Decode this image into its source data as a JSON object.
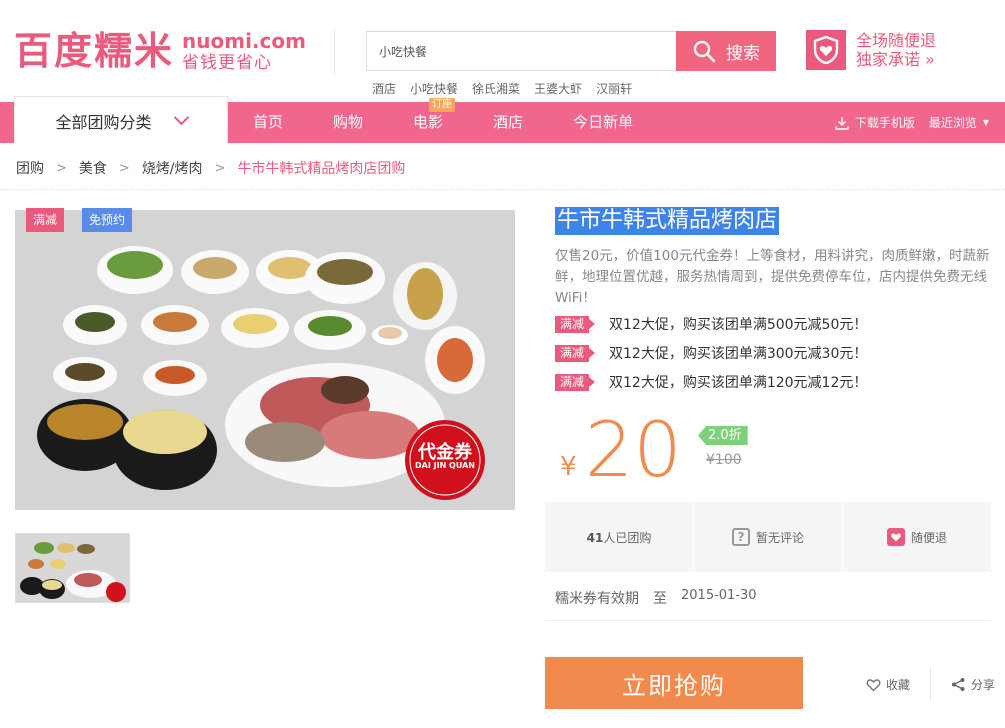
{
  "header": {
    "logo_cn": "百度糯米",
    "logo_en": "nuomi.com",
    "logo_slogan": "省钱更省心",
    "search": {
      "value": "小吃快餐",
      "button_label": "搜索"
    },
    "hot_words": [
      "酒店",
      "小吃快餐",
      "徐氏湘菜",
      "王婆大虾",
      "汉丽轩"
    ],
    "promise_line1": "全场随便退",
    "promise_line2": "独家承诺 »"
  },
  "nav": {
    "category_label": "全部团购分类",
    "links": [
      "首页",
      "购物",
      "电影",
      "酒店",
      "今日新单"
    ],
    "movie_tag": "订座",
    "download_label": "下载手机版",
    "recent_label": "最近浏览"
  },
  "breadcrumb": [
    "团购",
    "美食",
    "烧烤/烤肉",
    "牛市牛韩式精品烤肉店团购"
  ],
  "gallery": {
    "tag_full_reduction": "满减",
    "tag_no_reservation": "免预约",
    "coupon_text": "代金券",
    "coupon_sub": "DAI JIN QUAN"
  },
  "deal": {
    "title": "牛市牛韩式精品烤肉店",
    "description": "仅售20元，价值100元代金券！上等食材，用料讲究，肉质鲜嫩，时蔬新鲜，地理位置优越，服务热情周到，提供免费停车位，店内提供免费无线WiFi！",
    "promotions": [
      {
        "tag": "满减",
        "text": "双12大促，购买该团单满500元减50元！"
      },
      {
        "tag": "满减",
        "text": "双12大促，购买该团单满300元减30元！"
      },
      {
        "tag": "满减",
        "text": "双12大促，购买该团单满120元减12元！"
      }
    ],
    "currency": "¥",
    "price": "20",
    "discount": "2.0折",
    "original_price": "¥100",
    "stats": {
      "sold_count": "41",
      "sold_suffix": "人已团购",
      "reviews": "暂无评论",
      "refund": "随便退"
    },
    "validity_label": "糯米券有效期",
    "validity_to": "至",
    "validity_date": "2015-01-30",
    "buy_label": "立即抢购",
    "favorite_label": "收藏",
    "share_label": "分享"
  },
  "colors": {
    "brand_pink": "#ea5a7c",
    "nav_pink": "#f0668c",
    "price_orange": "#f28a4e",
    "discount_green": "#7fd07b",
    "title_highlight": "#3d83e8"
  }
}
